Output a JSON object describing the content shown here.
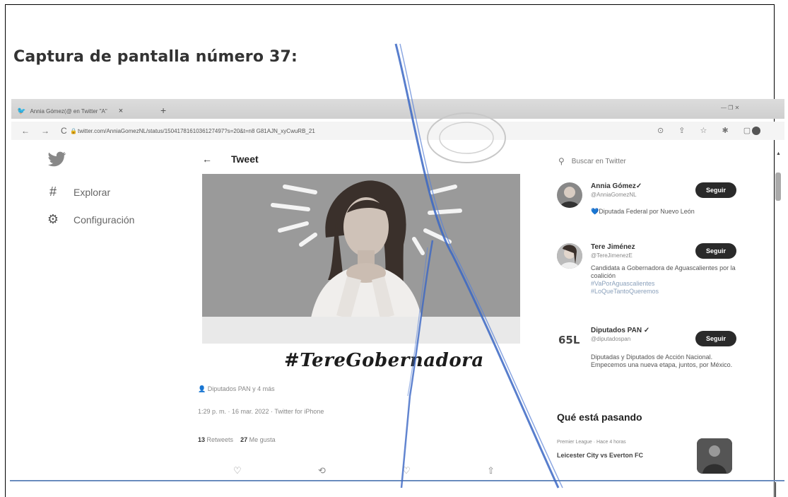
{
  "caption": "Captura de pantalla número 37:",
  "browser": {
    "tab_title": "Annia Gómez(@ en Twitter \"A\"",
    "tab_close": "×",
    "new_tab": "+",
    "window_controls": "— ❐ ✕",
    "url": "twitter.com/AnniaGomezNL/status/1504178161036127497?s=20&t=n8 G81AJN_xyCwuRB_21",
    "nav_back": "←",
    "nav_forward": "→",
    "nav_reload": "C",
    "lock": "🔒",
    "ext_icons": "⊙ ⇪ ☆ ✱ ▢"
  },
  "sidebar": {
    "logo_icon": "bird-icon",
    "items": [
      {
        "icon": "#",
        "label": "Explorar"
      },
      {
        "icon": "⚙",
        "label": "Configuración"
      }
    ]
  },
  "tweet": {
    "back": "←",
    "header": "Tweet",
    "image_hashtag": "#TereGobernadora",
    "tagged": "Diputados PAN y 4 más",
    "timestamp": "1:29 p. m. · 16 mar. 2022 · Twitter for iPhone",
    "retweets_count": "13",
    "retweets_label": "Retweets",
    "likes_count": "27",
    "likes_label": "Me gusta",
    "actions": [
      "♡",
      "⟲",
      "♡",
      "⇧"
    ]
  },
  "right": {
    "search_placeholder": "Buscar en Twitter",
    "accounts": [
      {
        "name": "Annia Gómez✓",
        "handle": "@AnniaGomezNL",
        "bio": "💙Diputada Federal por Nuevo León",
        "bio_extra": "",
        "follow": "Seguir"
      },
      {
        "name": "Tere Jiménez",
        "handle": "@TereJimenezE",
        "bio": "Candidata a Gobernadora de Aguascalientes por la coalición",
        "hashtags": [
          "#VaPorAguascalientes",
          "#LoQueTantoQueremos"
        ],
        "follow": "Seguir"
      },
      {
        "name": "Diputados PAN ✓",
        "handle": "@diputadospan",
        "bio": "Diputadas y Diputados de Acción Nacional. Empecemos una nueva etapa, juntos, por México.",
        "follow": "Seguir"
      }
    ],
    "trends_title": "Qué está pasando",
    "trend_meta": "Premier League · Hace 4 horas",
    "trend_name": "Leicester City vs Everton FC"
  },
  "colors": {
    "twitter_blue": "#1d9bf0",
    "pen_blue": "#3b67c4",
    "follow_bg": "#2a2a2a"
  }
}
